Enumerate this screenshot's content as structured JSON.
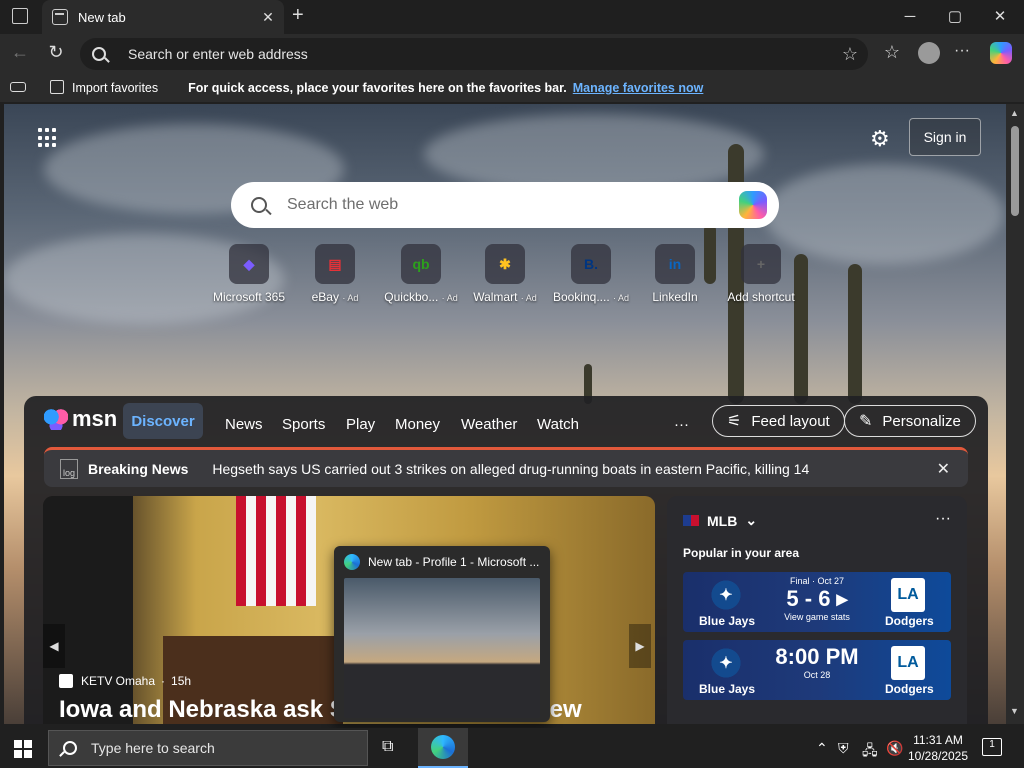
{
  "window": {
    "tab_title": "New tab",
    "tab_close": "✕",
    "new_tab": "+",
    "min": "─",
    "max": "▢",
    "close": "✕"
  },
  "toolbar": {
    "back": "←",
    "refresh": "↻",
    "address_placeholder": "Search or enter web address",
    "star": "☆",
    "favorites": "☆",
    "more": "···"
  },
  "favbar": {
    "import_label": "Import favorites",
    "message": "For quick access, place your favorites here on the favorites bar.",
    "manage_link": "Manage favorites now"
  },
  "ntp": {
    "signin_label": "Sign in",
    "search_placeholder": "Search the web",
    "shortcuts": [
      {
        "label": "Microsoft 365",
        "ad": "",
        "glyph": "◆",
        "color": "#7b5cff"
      },
      {
        "label": "eBay",
        "ad": "Ad",
        "glyph": "▤",
        "color": "#e53238"
      },
      {
        "label": "Quickbo...",
        "ad": "Ad",
        "glyph": "qb",
        "color": "#2ca01c"
      },
      {
        "label": "Walmart",
        "ad": "Ad",
        "glyph": "✱",
        "color": "#ffc220"
      },
      {
        "label": "Bookinq....",
        "ad": "Ad",
        "glyph": "B.",
        "color": "#003580"
      },
      {
        "label": "LinkedIn",
        "ad": "",
        "glyph": "in",
        "color": "#0a66c2"
      },
      {
        "label": "Add shortcut",
        "ad": "",
        "glyph": "+",
        "color": "#666666"
      }
    ]
  },
  "feed": {
    "logo": "msn",
    "tabs": [
      "Discover",
      "News",
      "Sports",
      "Play",
      "Money",
      "Weather",
      "Watch"
    ],
    "more": "···",
    "feed_layout": "Feed layout",
    "personalize": "Personalize",
    "breaking_logo": "log",
    "breaking_label": "Breaking News",
    "breaking_text": "Hegseth says US carried out 3 strikes on alleged drug-running boats in eastern Pacific, killing 14",
    "breaking_close": "✕",
    "hero_source": "KETV Omaha",
    "hero_age": "15h",
    "hero_title_left": "Iowa and Nebraska ask Su",
    "hero_title_right": "iew",
    "arrow_left": "◀",
    "arrow_right": "▶"
  },
  "thumbnail": {
    "title": "New tab - Profile 1 - Microsoft ..."
  },
  "sports": {
    "league": "MLB",
    "more": "···",
    "subtitle": "Popular in your area",
    "games": [
      {
        "home": "Blue Jays",
        "away": "Dodgers",
        "status": "Final · Oct 27",
        "score": "5 - 6 ▸",
        "detail": "View game stats"
      },
      {
        "home": "Blue Jays",
        "away": "Dodgers",
        "status": "",
        "score": "8:00 PM",
        "detail": "Oct 28"
      }
    ]
  },
  "taskbar": {
    "search_placeholder": "Type here to search",
    "time": "11:31 AM",
    "date": "10/28/2025",
    "notif_count": "1"
  }
}
